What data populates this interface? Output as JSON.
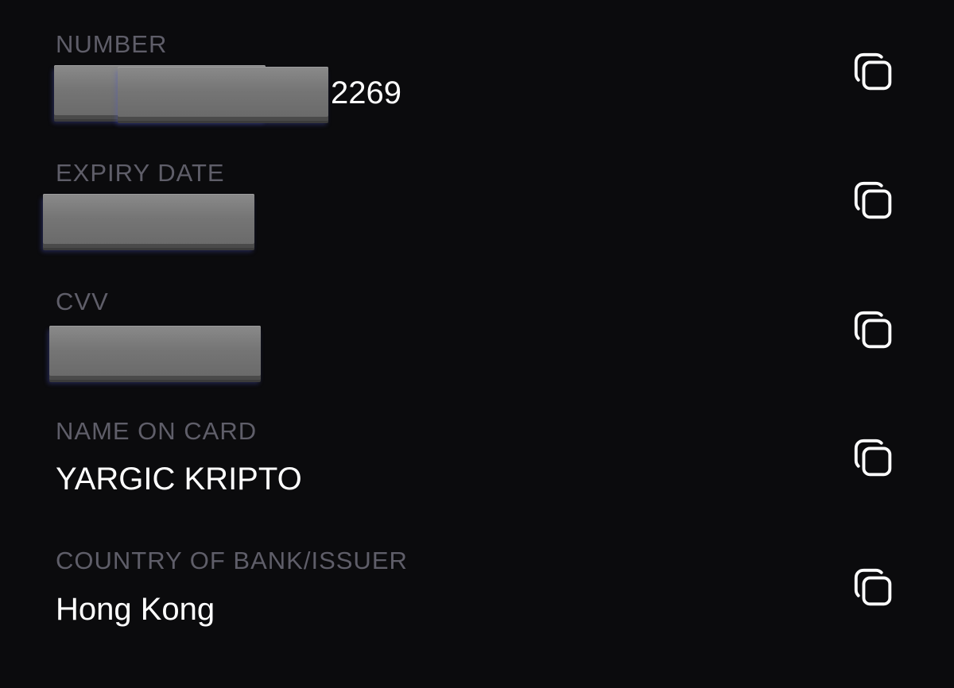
{
  "fields": [
    {
      "label": "NUMBER",
      "value_suffix": "2269",
      "value_redacted": true
    },
    {
      "label": "EXPIRY DATE",
      "value_redacted": true
    },
    {
      "label": "CVV",
      "value_redacted": true
    },
    {
      "label": "NAME ON CARD",
      "value": "YARGIC KRIPTO"
    },
    {
      "label": "COUNTRY OF BANK/ISSUER",
      "value": "Hong Kong"
    }
  ],
  "icons": {
    "copy": "copy-icon"
  },
  "colors": {
    "background": "#0b0b0d",
    "label": "#5f5e69",
    "value": "#ffffff",
    "redaction": "#7a7a7a"
  }
}
